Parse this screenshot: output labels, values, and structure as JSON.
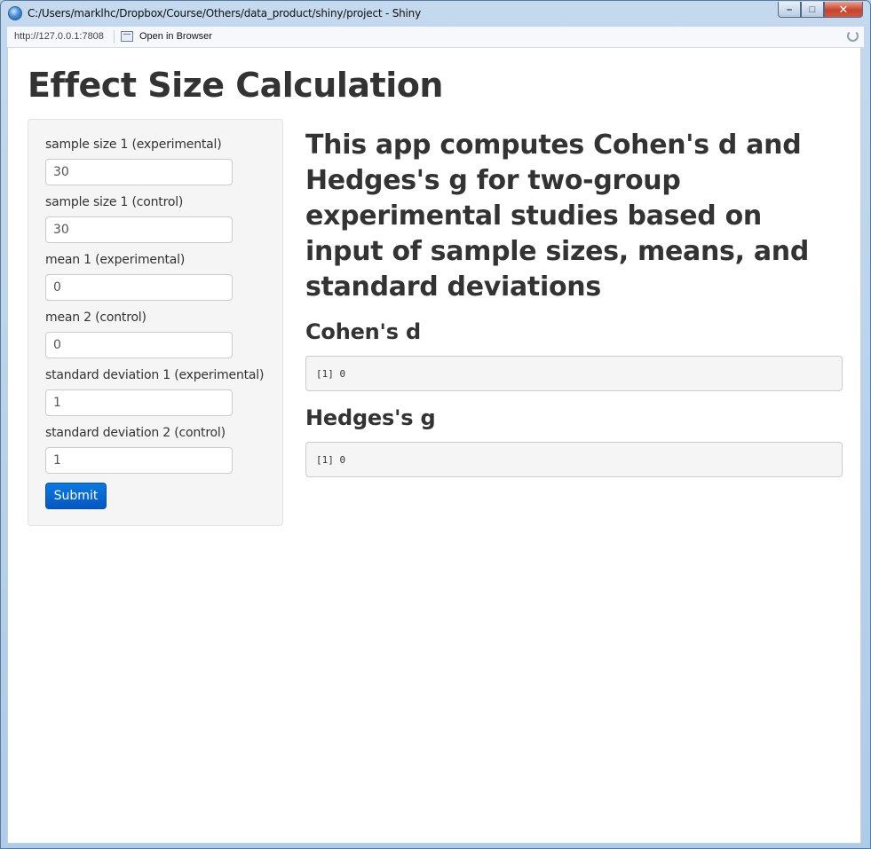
{
  "window": {
    "title": "C:/Users/marklhc/Dropbox/Course/Others/data_product/shiny/project - Shiny",
    "controls": {
      "minimize": "–",
      "maximize": "□",
      "close": "✕"
    }
  },
  "toolbar": {
    "url": "http://127.0.0.1:7808",
    "open_in_browser": "Open in Browser"
  },
  "page": {
    "title": "Effect Size Calculation"
  },
  "form": {
    "fields": [
      {
        "label": "sample size 1 (experimental)",
        "value": "30"
      },
      {
        "label": "sample size 1 (control)",
        "value": "30"
      },
      {
        "label": "mean 1 (experimental)",
        "value": "0"
      },
      {
        "label": "mean 2 (control)",
        "value": "0"
      },
      {
        "label": "standard deviation 1 (experimental)",
        "value": "1"
      },
      {
        "label": "standard deviation 2 (control)",
        "value": "1"
      }
    ],
    "submit_label": "Submit"
  },
  "main": {
    "intro": "This app computes Cohen's d and Hedges's g for two-group experimental studies based on input of sample sizes, means, and standard deviations",
    "cohen_heading": "Cohen's d",
    "cohen_output": "[1] 0",
    "hedges_heading": "Hedges's g",
    "hedges_output": "[1] 0"
  },
  "colors": {
    "primary_button": "#0a6fd8",
    "sidebar_bg": "#f5f5f5",
    "text": "#333333"
  }
}
